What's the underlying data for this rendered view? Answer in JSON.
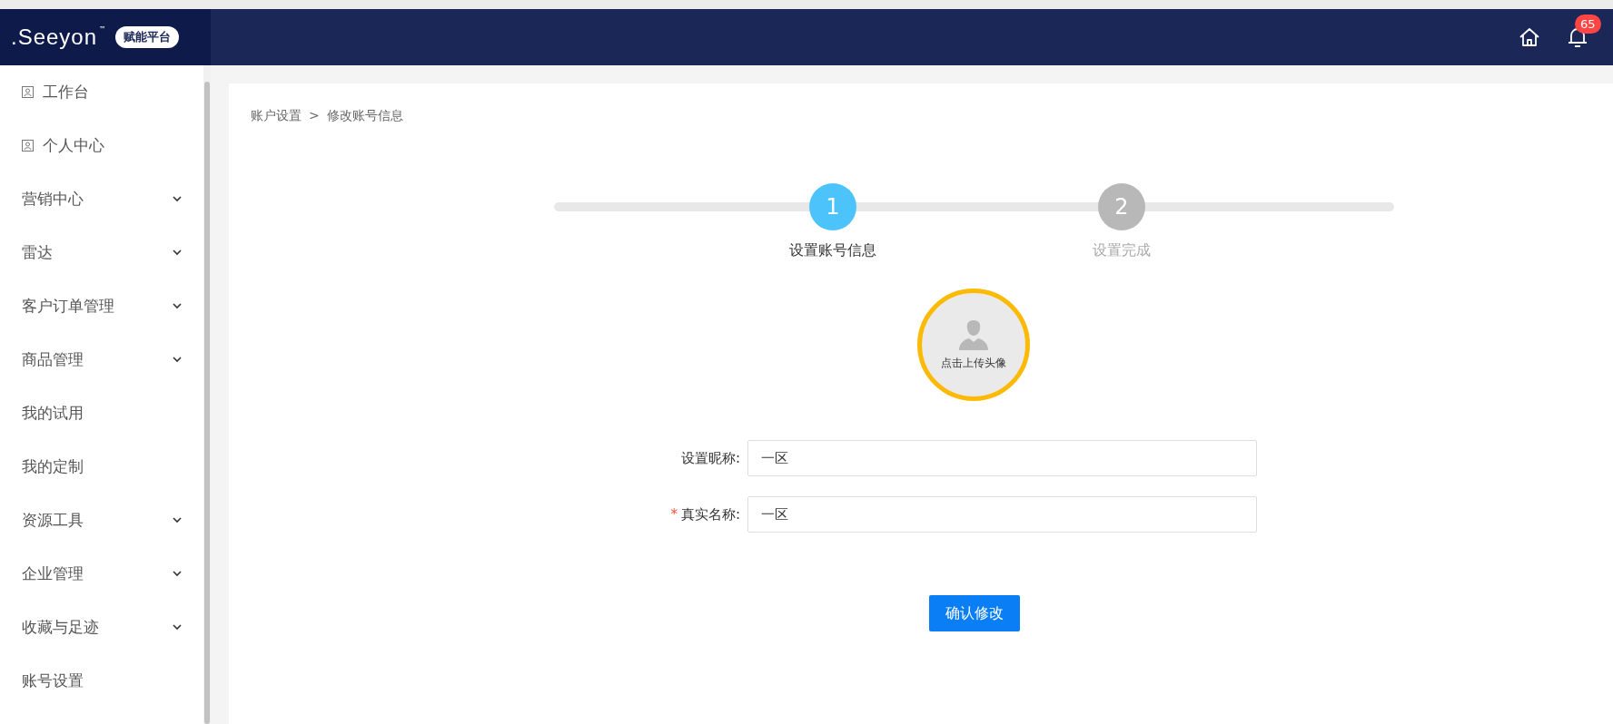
{
  "header": {
    "logo": ".Seeyon",
    "trademark": "™",
    "platform_badge": "赋能平台",
    "notification_count": "65"
  },
  "sidebar": {
    "items": [
      {
        "label": "工作台",
        "kind": "page"
      },
      {
        "label": "个人中心",
        "kind": "page"
      },
      {
        "label": "营销中心",
        "kind": "group",
        "expanded": false
      },
      {
        "label": "雷达",
        "kind": "group",
        "expanded": false
      },
      {
        "label": "客户订单管理",
        "kind": "group",
        "expanded": false
      },
      {
        "label": "商品管理",
        "kind": "group",
        "expanded": false
      },
      {
        "label": "我的试用",
        "kind": "link"
      },
      {
        "label": "我的定制",
        "kind": "link"
      },
      {
        "label": "资源工具",
        "kind": "group",
        "expanded": false
      },
      {
        "label": "企业管理",
        "kind": "group",
        "expanded": false
      },
      {
        "label": "收藏与足迹",
        "kind": "group",
        "expanded": false
      },
      {
        "label": "账号设置",
        "kind": "link"
      }
    ]
  },
  "breadcrumb": [
    "账户设置",
    "修改账号信息"
  ],
  "breadcrumb_separator": ">",
  "steps": [
    {
      "number": "1",
      "label": "设置账号信息",
      "selected": true
    },
    {
      "number": "2",
      "label": "设置完成",
      "selected": false
    }
  ],
  "avatar": {
    "caption": "点击上传头像"
  },
  "form": {
    "fields": [
      {
        "label": "设置昵称:",
        "value": "一区",
        "required": false
      },
      {
        "label": "真实名称:",
        "value": "一区",
        "required": true
      }
    ],
    "required_mark": "*"
  },
  "submit_button": "确认修改"
}
